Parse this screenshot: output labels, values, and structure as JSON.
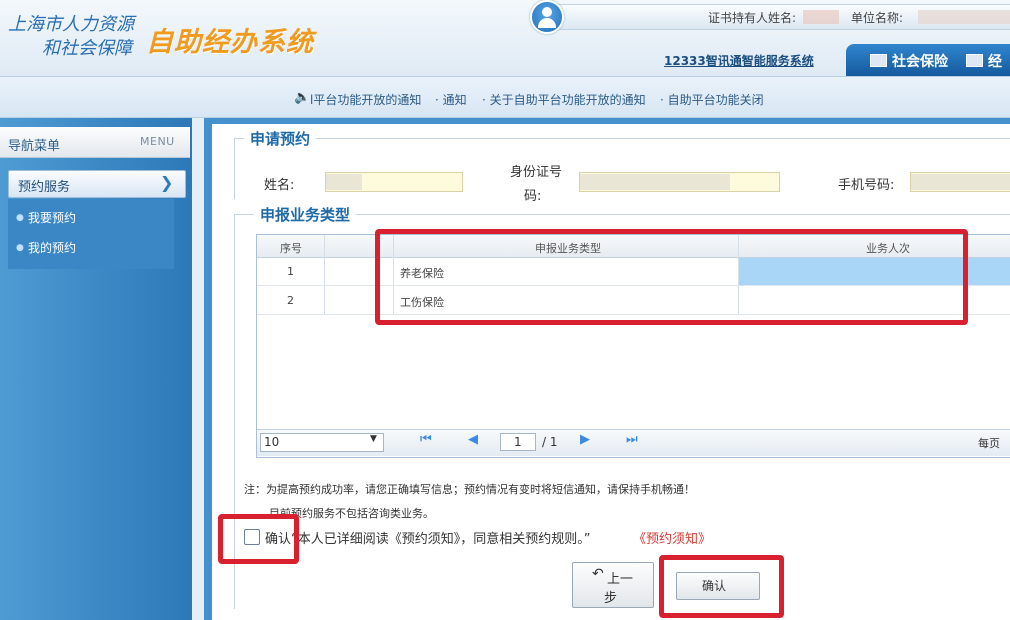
{
  "header": {
    "logo_line1": "上海市人力资源",
    "logo_line2": "和社会保障",
    "system_title": "自助经办系统",
    "cert_holder_label": "证书持有人姓名:",
    "unit_label": "单位名称:",
    "smart_service_link": "12333智讯通智能服务系统",
    "tabs": [
      "社会保险",
      "经"
    ]
  },
  "notices": [
    "l平台功能开放的通知",
    "· 通知",
    "· 关于自助平台功能开放的通知",
    "· 自助平台功能关闭"
  ],
  "sidebar": {
    "title": "导航菜单",
    "menu_label": "MENU",
    "group": "预约服务",
    "items": [
      "我要预约",
      "我的预约"
    ]
  },
  "form": {
    "apply_legend": "申请预约",
    "name_label": "姓名:",
    "id_label_line1": "身份证号",
    "id_label_line2": "码:",
    "phone_label": "手机号码:"
  },
  "business": {
    "legend": "申报业务类型",
    "columns": [
      "序号",
      "",
      "申报业务类型",
      "业务人次"
    ],
    "rows": [
      {
        "no": "1",
        "type": "养老保险",
        "count": ""
      },
      {
        "no": "2",
        "type": "工伤保险",
        "count": ""
      }
    ],
    "pager": {
      "page_size": "10",
      "current_page": "1",
      "total": "/ 1",
      "per_page": "每页"
    }
  },
  "notes": {
    "note1": "注：为提高预约成功率，请您正确填写信息；预约情况有变时将短信通知，请保持手机畅通！",
    "note2": "目前预约服务不包括咨询类业务。",
    "agree_text": "确认“本人已详细阅读《预约须知》，同意相关预约规则。”",
    "notice_link": "《预约须知》"
  },
  "buttons": {
    "prev_line1": "上一",
    "prev_line2": "步",
    "confirm": "确认"
  },
  "colors": {
    "annotation": "#d8202f",
    "brand_blue": "#2a6fb3",
    "title_orange": "#f29a1e",
    "selected_cell": "#a9d5f7"
  }
}
